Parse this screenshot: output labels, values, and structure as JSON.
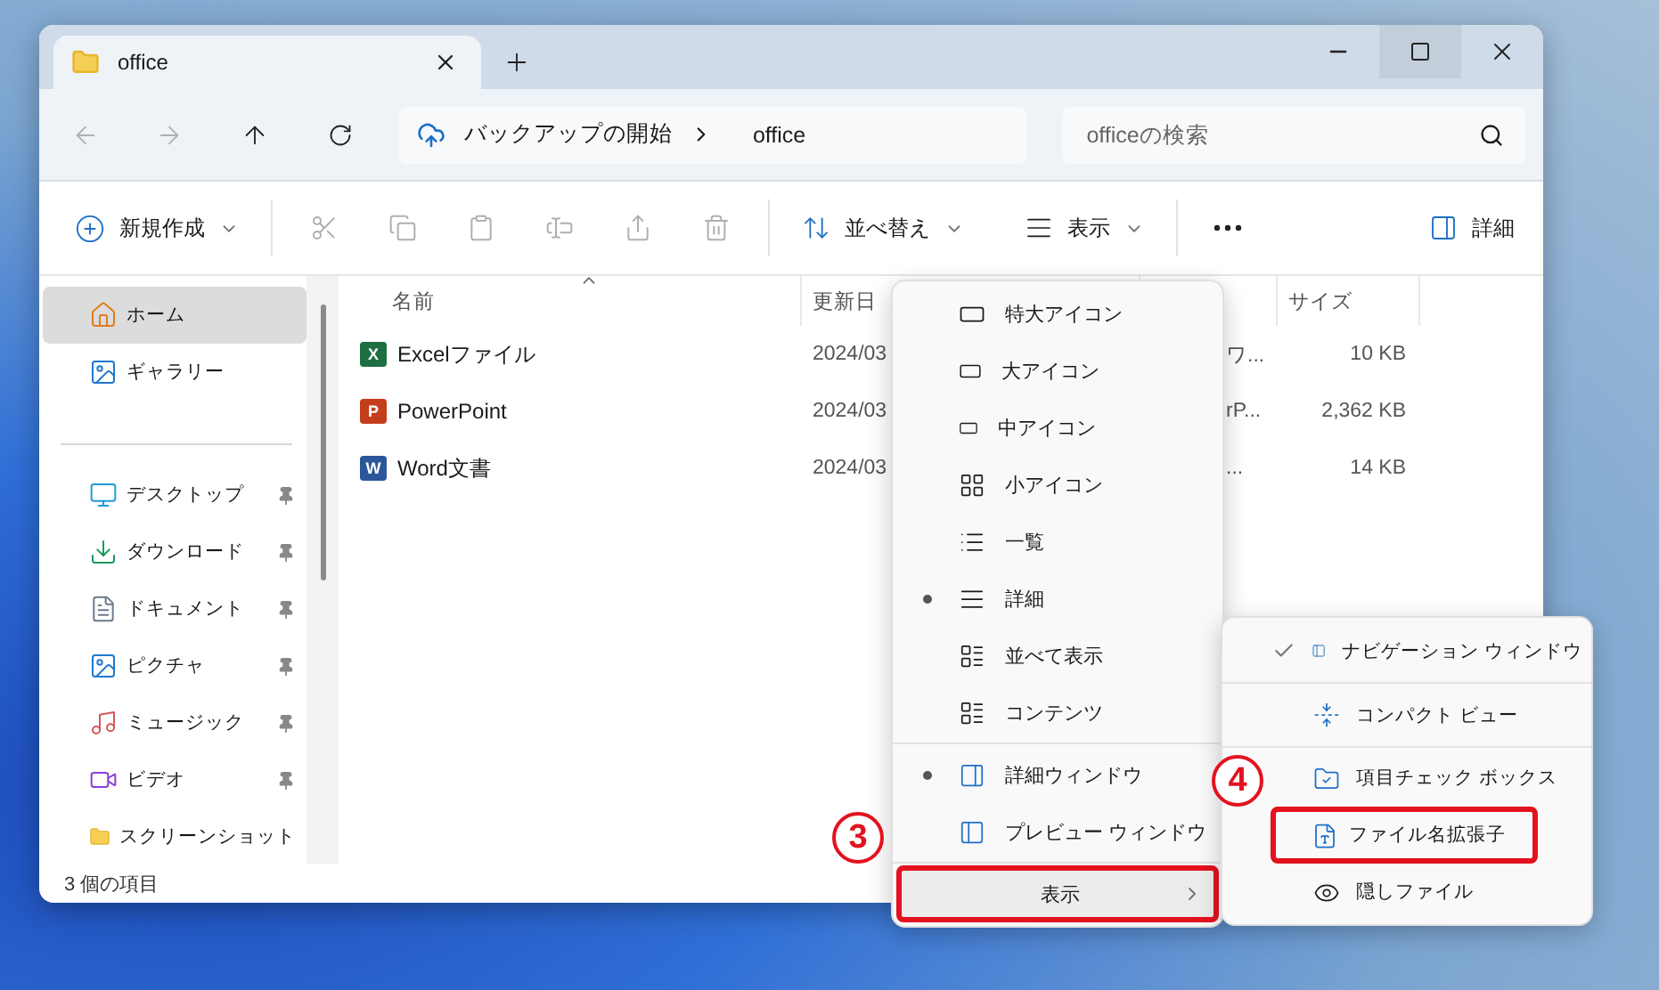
{
  "window": {
    "tab_title": "office"
  },
  "address_bar": {
    "segments": [
      "バックアップの開始",
      "office"
    ],
    "search_placeholder": "officeの検索"
  },
  "toolbar": {
    "new_label": "新規作成",
    "actions": [
      {
        "disabled": true
      },
      {
        "disabled": true
      },
      {
        "disabled": true
      },
      {
        "disabled": true
      },
      {
        "disabled": true
      },
      {
        "disabled": true
      }
    ],
    "sort_label": "並べ替え",
    "view_label": "表示",
    "details_label": "詳細"
  },
  "sidebar": {
    "groups": [
      {
        "items": [
          {
            "label": "ホーム",
            "selected": true,
            "pinned": false
          },
          {
            "label": "ギャラリー",
            "selected": false,
            "pinned": false
          }
        ]
      },
      {
        "items": [
          {
            "label": "デスクトップ",
            "selected": false,
            "pinned": true
          },
          {
            "label": "ダウンロード",
            "selected": false,
            "pinned": true
          },
          {
            "label": "ドキュメント",
            "selected": false,
            "pinned": true
          },
          {
            "label": "ピクチャ",
            "selected": false,
            "pinned": true
          },
          {
            "label": "ミュージック",
            "selected": false,
            "pinned": true
          },
          {
            "label": "ビデオ",
            "selected": false,
            "pinned": true
          },
          {
            "label": "スクリーンショット",
            "selected": false,
            "pinned": false
          }
        ]
      }
    ]
  },
  "table": {
    "columns": [
      "名前",
      "更新日",
      "サイズ"
    ],
    "rows": [
      {
        "badge": "X",
        "color": "#1d6f42",
        "name": "Excelファイル",
        "date": "2024/03",
        "column_3": "ワ...",
        "size": "10 KB"
      },
      {
        "badge": "P",
        "color": "#c43e1c",
        "name": "PowerPoint",
        "date": "2024/03",
        "column_3": "rP...",
        "size": "2,362 KB"
      },
      {
        "badge": "W",
        "color": "#2b579a",
        "name": "Word文書",
        "date": "2024/03",
        "column_3": "...",
        "size": "14 KB"
      }
    ]
  },
  "status_bar": {
    "count": "3 個の項目"
  },
  "view_menu": {
    "groups": [
      {
        "items": [
          {
            "label": "特大アイコン",
            "selected": false,
            "hovered": false,
            "submenu": false,
            "callout_target": false
          },
          {
            "label": "大アイコン",
            "selected": false,
            "hovered": false,
            "submenu": false,
            "callout_target": false
          },
          {
            "label": "中アイコン",
            "selected": false,
            "hovered": false,
            "submenu": false,
            "callout_target": false
          },
          {
            "label": "小アイコン",
            "selected": false,
            "hovered": false,
            "submenu": false,
            "callout_target": false
          },
          {
            "label": "一覧",
            "selected": false,
            "hovered": false,
            "submenu": false,
            "callout_target": false
          },
          {
            "label": "詳細",
            "selected": true,
            "hovered": false,
            "submenu": false,
            "callout_target": false
          },
          {
            "label": "並べて表示",
            "selected": false,
            "hovered": false,
            "submenu": false,
            "callout_target": false
          },
          {
            "label": "コンテンツ",
            "selected": false,
            "hovered": false,
            "submenu": false,
            "callout_target": false
          }
        ]
      },
      {
        "items": [
          {
            "label": "詳細ウィンドウ",
            "selected": true,
            "hovered": false,
            "submenu": false,
            "callout_target": false
          },
          {
            "label": "プレビュー ウィンドウ",
            "selected": false,
            "hovered": false,
            "submenu": false,
            "callout_target": false
          }
        ]
      },
      {
        "items": [
          {
            "label": "表示",
            "selected": false,
            "hovered": true,
            "submenu": true,
            "callout_target": true
          }
        ]
      }
    ]
  },
  "sub_menu": {
    "groups": [
      {
        "items": [
          {
            "label": "ナビゲーション ウィンドウ",
            "checked": true,
            "callout_target": false
          }
        ]
      },
      {
        "items": [
          {
            "label": "コンパクト ビュー",
            "checked": false,
            "callout_target": false
          }
        ]
      },
      {
        "items": [
          {
            "label": "項目チェック ボックス",
            "checked": false,
            "callout_target": false
          },
          {
            "label": "ファイル名拡張子",
            "checked": false,
            "callout_target": true
          },
          {
            "label": "隠しファイル",
            "checked": false,
            "callout_target": false
          }
        ]
      }
    ]
  },
  "callouts": [
    {
      "label": "3"
    },
    {
      "label": "4"
    }
  ]
}
